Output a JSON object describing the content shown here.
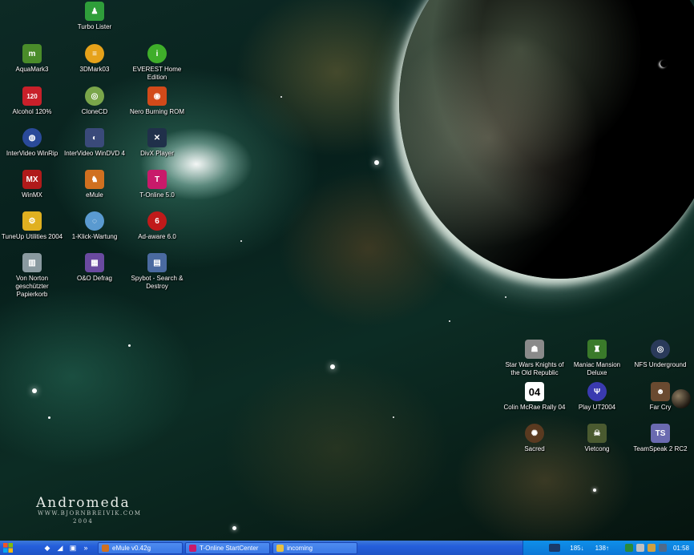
{
  "wallpaper": {
    "title": "Andromeda",
    "url": "WWW.BJORNBREIVIK.COM",
    "year": "2004"
  },
  "desktop_icons": [
    {
      "label": "Turbo Lister",
      "glyph": "♟",
      "color": "#2f9e3a",
      "icon": "turbo-lister-icon"
    },
    {
      "label": "AquaMark3",
      "glyph": "m",
      "color": "#4a8c2a",
      "icon": "aquamark-icon"
    },
    {
      "label": "3DMark03",
      "glyph": "≡",
      "color": "#e6a21a",
      "icon": "3dmark-icon"
    },
    {
      "label": "EVEREST Home Edition",
      "glyph": "i",
      "color": "#3fae2a",
      "icon": "everest-icon"
    },
    {
      "label": "Alcohol 120%",
      "glyph": "120",
      "color": "#c8202a",
      "icon": "alcohol-icon"
    },
    {
      "label": "CloneCD",
      "glyph": "◎",
      "color": "#7aa64a",
      "icon": "clonecd-icon"
    },
    {
      "label": "Nero Burning ROM",
      "glyph": "◉",
      "color": "#d24a1a",
      "icon": "nero-icon"
    },
    {
      "label": "InterVideo WinRip",
      "glyph": "◍",
      "color": "#2a4a9a",
      "icon": "winrip-icon"
    },
    {
      "label": "InterVideo WinDVD 4",
      "glyph": "◐",
      "color": "#3a4a7a",
      "icon": "windvd-icon"
    },
    {
      "label": "DivX Player",
      "glyph": "✕",
      "color": "#20304a",
      "icon": "divx-icon"
    },
    {
      "label": "WinMX",
      "glyph": "MX",
      "color": "#b01a1a",
      "icon": "winmx-icon"
    },
    {
      "label": "eMule",
      "glyph": "♞",
      "color": "#d07020",
      "icon": "emule-icon"
    },
    {
      "label": "T-Online 5.0",
      "glyph": "T",
      "color": "#c81a6a",
      "icon": "t-online-icon"
    },
    {
      "label": "TuneUp Utilities 2004",
      "glyph": "⚙",
      "color": "#e0b020",
      "icon": "tuneup-icon"
    },
    {
      "label": "1-Klick-Wartung",
      "glyph": "◌",
      "color": "#5a9ad0",
      "icon": "one-click-icon"
    },
    {
      "label": "Ad-aware 6.0",
      "glyph": "6",
      "color": "#c01a1a",
      "icon": "adaware-icon"
    },
    {
      "label": "Von Norton geschützter Papierkorb",
      "glyph": "▥",
      "color": "#8a9aa0",
      "icon": "recycle-bin-icon"
    },
    {
      "label": "O&O Defrag",
      "glyph": "▦",
      "color": "#6a4aa0",
      "icon": "defrag-icon"
    },
    {
      "label": "Spybot - Search & Destroy",
      "glyph": "▤",
      "color": "#4a6aa0",
      "icon": "spybot-icon"
    },
    {
      "label": "Star Wars Knights of the Old Republic",
      "glyph": "☗",
      "color": "#8a8a8a",
      "icon": "kotor-icon"
    },
    {
      "label": "Maniac Mansion Deluxe",
      "glyph": "♜",
      "color": "#3a7a2a",
      "icon": "maniac-mansion-icon"
    },
    {
      "label": "NFS Underground",
      "glyph": "◎",
      "color": "#2a3a5a",
      "icon": "nfs-icon"
    },
    {
      "label": "Colin McRae Rally 04",
      "glyph": "04",
      "color": "#ffffff",
      "icon": "colin-mcrae-icon"
    },
    {
      "label": "Play UT2004",
      "glyph": "Ψ",
      "color": "#3a3ab0",
      "icon": "ut2004-icon"
    },
    {
      "label": "Far Cry",
      "glyph": "☻",
      "color": "#6a4a30",
      "icon": "far-cry-icon"
    },
    {
      "label": "Sacred",
      "glyph": "✺",
      "color": "#5a3a20",
      "icon": "sacred-icon"
    },
    {
      "label": "Vietcong",
      "glyph": "☠",
      "color": "#4a5a30",
      "icon": "vietcong-icon"
    },
    {
      "label": "TeamSpeak 2 RC2",
      "glyph": "TS",
      "color": "#6a6ab0",
      "icon": "teamspeak-icon"
    }
  ],
  "taskbar": {
    "quick_launch": [
      {
        "glyph": "◆",
        "icon": "desktop-icon"
      },
      {
        "glyph": "◢",
        "icon": "explorer-icon"
      },
      {
        "glyph": "▣",
        "icon": "media-icon"
      },
      {
        "glyph": "»",
        "icon": "more-icon"
      }
    ],
    "buttons": [
      {
        "label": "eMule v0.42g",
        "color": "#d07020",
        "icon": "emule-icon"
      },
      {
        "label": "T-Online StartCenter",
        "color": "#c81a6a",
        "icon": "t-online-icon"
      },
      {
        "label": "incoming",
        "color": "#e8c040",
        "icon": "folder-icon"
      }
    ],
    "tray": {
      "download": "185↓",
      "upload": "138↑",
      "clock": "01:58"
    }
  },
  "colors": {
    "taskbar": "#245edb",
    "tray": "#0f8fe8"
  }
}
